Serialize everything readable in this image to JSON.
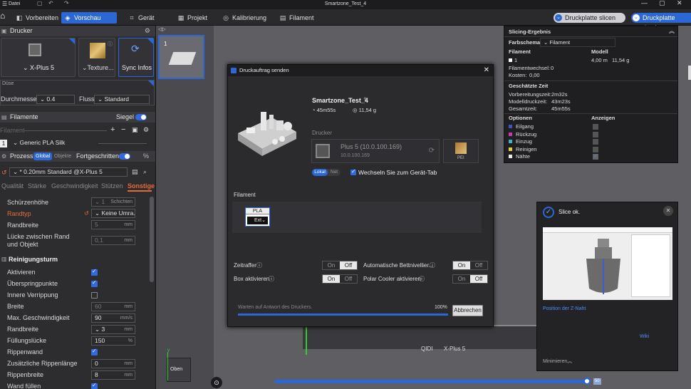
{
  "titlebar": {
    "menu": "Datei",
    "title": "Smartzone_Test_4"
  },
  "menubar": {
    "tabs": [
      {
        "label": "Vorbereiten"
      },
      {
        "label": "Vorschau"
      },
      {
        "label": "Gerät"
      },
      {
        "label": "Projekt"
      },
      {
        "label": "Kalibrierung"
      },
      {
        "label": "Filament"
      }
    ],
    "slice_button": "Druckplatte slicen",
    "print_button": "Druckplatte druck"
  },
  "left": {
    "printer_header": "Drucker",
    "printer_name": "X-Plus 5",
    "plate_name": "Texture...",
    "sync_label": "Sync Infos",
    "nozzle_label": "Düse",
    "diameter_label": "Durchmesser",
    "diameter_value": "0.4",
    "flow_label": "Fluss",
    "flow_value": "Standard",
    "filaments_header": "Filamente",
    "siegel_label": "Siegel",
    "filament_label": "Filament",
    "filament_index": "1",
    "filament_value": "Generic PLA Silk",
    "process_label": "Prozess",
    "process_global": "Global",
    "process_objects": "Objekte",
    "advanced_label": "Fortgeschritten",
    "profile_value": "* 0.20mm Standard @X-Plus 5",
    "subtabs": [
      "Qualität",
      "Stärke",
      "Geschwindigkeit",
      "Stützen",
      "Sonstige"
    ],
    "skirt_height_label": "Schürzenhöhe",
    "skirt_height_value": "1",
    "skirt_height_unit": "Schichten",
    "edge_type_label": "Randtyp",
    "edge_type_value": "Keine Umra...",
    "edge_width_label": "Randbreite",
    "edge_width_value": "5",
    "edge_width_unit": "mm",
    "gap_label": "Lücke zwischen Rand und Objekt",
    "gap_value": "0,1",
    "gap_unit": "mm",
    "tower_header": "Reinigungsturm",
    "active_label": "Aktivieren",
    "skip_label": "Überspringpunkte",
    "inner_label": "Innere Verrippung",
    "width_label": "Breite",
    "width_value": "60",
    "width_unit": "mm",
    "maxspeed_label": "Max. Geschwindigkeit",
    "maxspeed_value": "90",
    "maxspeed_unit": "mm/s",
    "edgewidth2_label": "Randbreite",
    "edgewidth2_value": "3",
    "edgewidth2_unit": "mm",
    "fillgap_label": "Füllungslücke",
    "fillgap_value": "150",
    "fillgap_unit": "%",
    "ribwall_label": "Rippenwand",
    "extra_rib_label": "Zusätzliche Rippenlänge",
    "extra_rib_value": "0",
    "extra_rib_unit": "mm",
    "rib_width_label": "Rippenbreite",
    "rib_width_value": "8",
    "rib_width_unit": "mm",
    "fill_wall_label": "Wand füllen"
  },
  "viewport": {
    "plate_number": "1",
    "view_label": "Oben",
    "printer_brand": "QIDI",
    "printer_model": "X-Plus 5",
    "layer_value": "50"
  },
  "dialog": {
    "title": "Druckauftrag senden",
    "project_name": "Smartzone_Test_4",
    "time": "45m55s",
    "weight": "11,54 g",
    "printer_header": "Drucker",
    "printer_name": "Plus 5 (10.0.100.169)",
    "printer_ip": "10.0.100.169",
    "plate_label": "PEI",
    "lokal": "Lokal",
    "net": "Net",
    "switch_label": "Wechseln Sie zum Gerät-Tab",
    "filament_header": "Filament",
    "fil_type": "PLA",
    "fil_slot": "Ext",
    "timelapse_label": "Zeitraffer",
    "bedlevel_label": "Automatische Bettnivellier...",
    "box_label": "Box aktivieren",
    "polar_label": "Polar Cooler aktivieren",
    "on": "On",
    "off": "Off",
    "status_text": "Warten auf Antwort des Druckers.",
    "progress_percent": "100%",
    "progress": 1.0,
    "cancel_button": "Abbrechen"
  },
  "result": {
    "title": "Slicing-Ergebnis",
    "scheme_label": "Farbschema",
    "scheme_value": "Filament",
    "col_filament": "Filament",
    "col_model": "Modell",
    "row1_index": "1",
    "row1_len": "4,00 m",
    "row1_weight": "11,54 g",
    "filchange": "Filamentwechsel:",
    "filchange_val": "0",
    "cost": "Kosten:",
    "cost_val": "0,00",
    "time_header": "Geschätzte Zeit",
    "prep_label": "Vorbereitungszeit:",
    "prep_val": "2m32s",
    "model_time_label": "Modelldruckzeit:",
    "model_time_val": "43m23s",
    "total_label": "Gesamtzeit:",
    "total_val": "45m55s",
    "options_header": "Optionen",
    "show_header": "Anzeigen",
    "options": [
      {
        "label": "Eilgang",
        "color": "#3a55c8",
        "checked": false
      },
      {
        "label": "Rückzug",
        "color": "#c83ab4",
        "checked": false
      },
      {
        "label": "Einzug",
        "color": "#3ab4c8",
        "checked": false
      },
      {
        "label": "Reinigen",
        "color": "#e0d23a",
        "checked": false
      },
      {
        "label": "Nähte",
        "color": "#e8e8e8",
        "checked": true
      }
    ]
  },
  "sliceok": {
    "title": "Slice ok.",
    "link1": "Position der Z-Naht",
    "link2": "Wiki",
    "minimize": "Minimieren"
  },
  "colors": {
    "accent": "#2c67d6",
    "panel": "#2d2d30",
    "viewport": "#5e5e63"
  }
}
